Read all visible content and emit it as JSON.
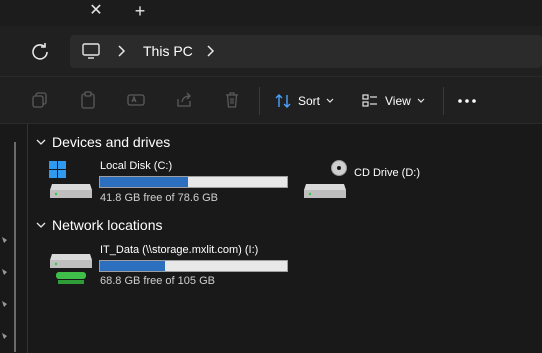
{
  "tabbar": {
    "close_icon": "close-icon",
    "new_tab_icon": "plus-icon"
  },
  "address": {
    "location_icon": "computer-icon",
    "crumb": "This PC",
    "refresh_icon": "refresh-icon"
  },
  "toolbar": {
    "sort_label": "Sort",
    "view_label": "View",
    "icons": [
      "copy-icon",
      "paste-icon",
      "rename-icon",
      "share-icon",
      "delete-icon"
    ]
  },
  "groups": {
    "devices": {
      "label": "Devices and drives"
    },
    "network": {
      "label": "Network locations"
    }
  },
  "drives": [
    {
      "name": "Local Disk (C:)",
      "free": "41.8 GB free of 78.6 GB",
      "used_fraction": 0.47,
      "icon": "windows-drive-icon"
    },
    {
      "name": "CD Drive (D:)",
      "icon": "cd-drive-icon"
    },
    {
      "name": "IT_Data (\\\\storage.mxlit.com) (I:)",
      "free": "68.8 GB free of 105 GB",
      "used_fraction": 0.35,
      "icon": "network-drive-icon"
    }
  ],
  "colors": {
    "accent": "#2c6fbf",
    "background": "#191919"
  }
}
